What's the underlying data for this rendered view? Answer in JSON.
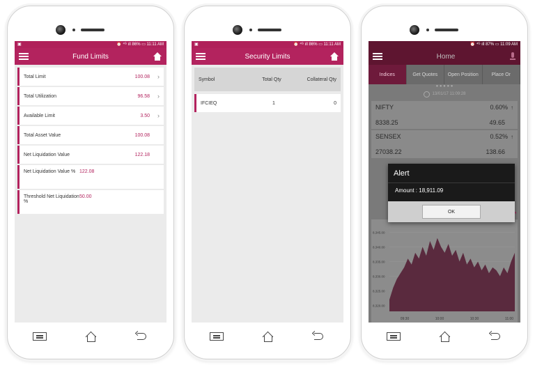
{
  "phones": {
    "fund": {
      "status": {
        "left": "▣",
        "right": "⏰ ⁴ᴳ ıll 86% ▭ 11:11 AM"
      },
      "title": "Fund Limits",
      "rows": [
        {
          "label": "Total Limit",
          "value": "100.08",
          "chevron": true
        },
        {
          "label": "Total Utilization",
          "value": "96.58",
          "chevron": true
        },
        {
          "label": "Available Limit",
          "value": "3.50",
          "chevron": true
        },
        {
          "label": "Total Asset Value",
          "value": "100.08",
          "chevron": false
        },
        {
          "label": "Net Liquidation Value",
          "value": "122.18",
          "chevron": false
        },
        {
          "label": "Net Liquidation Value %",
          "value": "122.08",
          "chevron": false
        },
        {
          "label": "Threshold Net Liquidation %",
          "value": "50.00",
          "chevron": false
        }
      ]
    },
    "security": {
      "status": {
        "left": "▣",
        "right": "⏰ ⁴ᴳ ıll 86% ▭ 11:11 AM"
      },
      "title": "Security Limits",
      "headers": {
        "symbol": "Symbol",
        "total": "Total Qty",
        "collateral": "Collateral Qty"
      },
      "rows": [
        {
          "symbol": "IFCIEQ",
          "total": "1",
          "collateral": "0"
        }
      ]
    },
    "home": {
      "status": {
        "left": "",
        "right": "⏰ ⁴ᴳ ıll 87% ▭ 11:09 AM"
      },
      "title": "Home",
      "tabs": [
        "Indices",
        "Get Quotes",
        "Open Position",
        "Place Or"
      ],
      "timestamp": "13/01/17 11:09:28",
      "indices": [
        {
          "name": "NIFTY",
          "percent": "0.60%",
          "value": "8338.25",
          "change": "49.65"
        },
        {
          "name": "SENSEX",
          "percent": "0.52%",
          "value": "27038.22",
          "change": "138.66"
        }
      ],
      "alert": {
        "title": "Alert",
        "message": "Amount : 18,911.09",
        "ok": "OK"
      },
      "chart_data": {
        "type": "area",
        "y_ticks": [
          "8,345.00",
          "8,340.00",
          "8,335.00",
          "8,330.00",
          "8,325.00",
          "8,320.00"
        ],
        "x_ticks": [
          "09:30",
          "10:00",
          "10:30",
          "11:00"
        ],
        "ylim": [
          8318,
          8347
        ],
        "values": [
          8322,
          8326,
          8329,
          8331,
          8333,
          8336,
          8334,
          8338,
          8336,
          8340,
          8337,
          8342,
          8339,
          8343,
          8340,
          8338,
          8341,
          8337,
          8339,
          8335,
          8338,
          8334,
          8336,
          8333,
          8335,
          8332,
          8334,
          8331,
          8333,
          8332,
          8330,
          8333,
          8331,
          8335,
          8338
        ]
      }
    }
  }
}
